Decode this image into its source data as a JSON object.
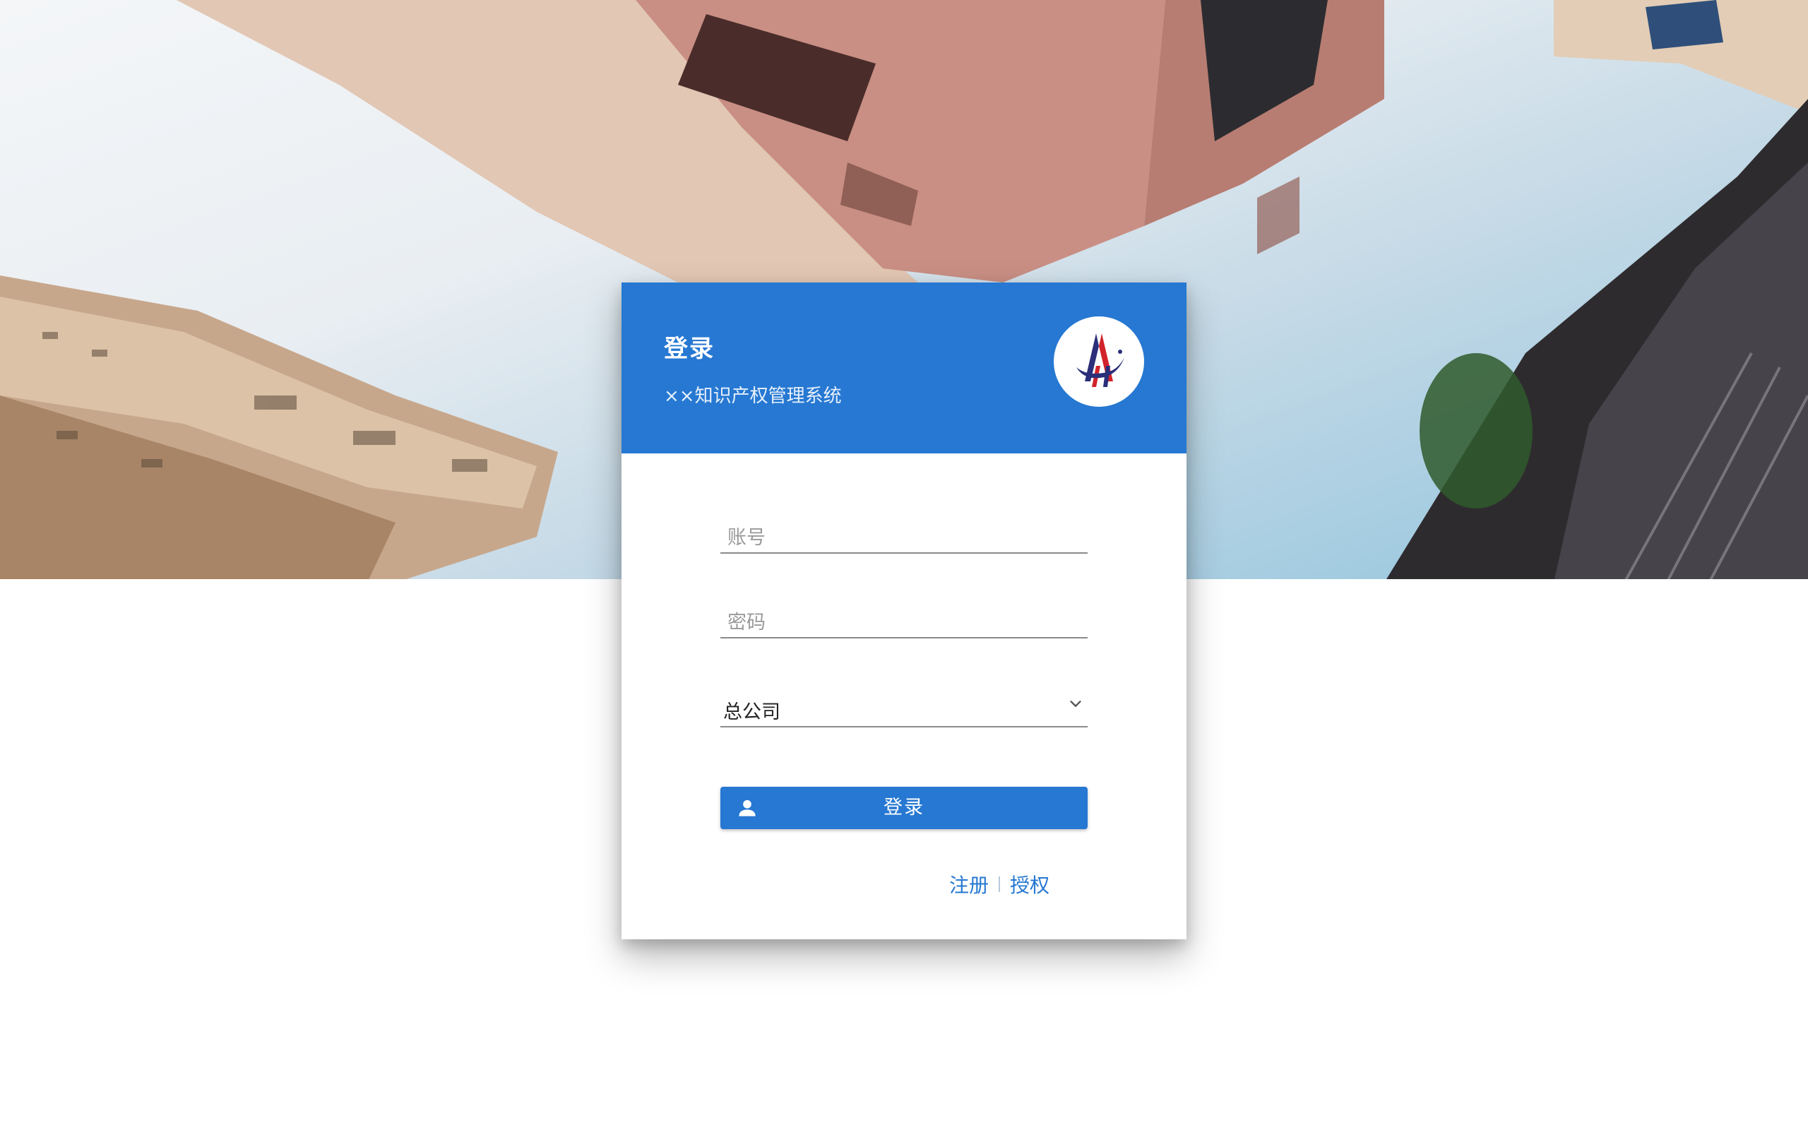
{
  "header": {
    "title": "登录",
    "subtitle": "××知识产权管理系统"
  },
  "logo": {
    "icon": "company-logo",
    "colors": [
      "#2b2f7a",
      "#d2232a"
    ]
  },
  "form": {
    "account_placeholder": "账号",
    "account_value": "",
    "password_placeholder": "密码",
    "password_value": "",
    "company_selected": "总公司",
    "login_label": "登录",
    "login_icon": "person-icon"
  },
  "links": {
    "register": "注册",
    "authorize": "授权"
  },
  "colors": {
    "primary": "#2678d2",
    "background": "#ffffff"
  }
}
